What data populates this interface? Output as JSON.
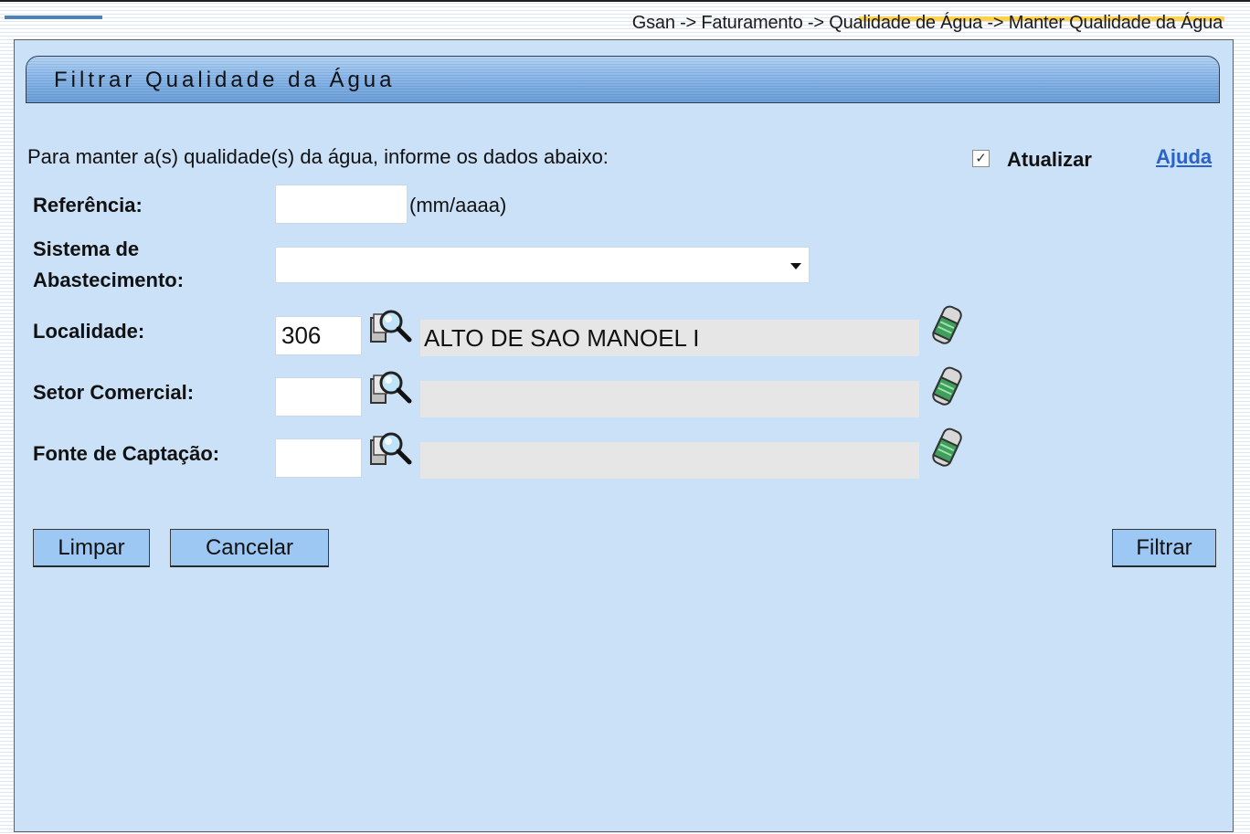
{
  "breadcrumb": "Gsan -> Faturamento -> Qualidade de Água -> Manter Qualidade da Água",
  "panel": {
    "title": "Filtrar Qualidade da Água"
  },
  "form": {
    "intro": "Para manter a(s) qualidade(s) da água, informe os dados abaixo:",
    "atualizar_label": "Atualizar",
    "atualizar_checked": true,
    "ajuda_link": "Ajuda",
    "referencia": {
      "label": "Referência:",
      "value": "",
      "hint": "(mm/aaaa)"
    },
    "sistema": {
      "label_line1": "Sistema de",
      "label_line2": "Abastecimento:",
      "selected": ""
    },
    "localidade": {
      "label": "Localidade:",
      "code": "306",
      "description": "ALTO DE SAO MANOEL I"
    },
    "setor": {
      "label": "Setor Comercial:",
      "code": "",
      "description": ""
    },
    "fonte": {
      "label": "Fonte de Captação:",
      "code": "",
      "description": ""
    }
  },
  "buttons": {
    "limpar": "Limpar",
    "cancelar": "Cancelar",
    "filtrar": "Filtrar"
  },
  "icons": {
    "search": "magnifier-search-icon",
    "clear": "eraser-icon",
    "checkbox": "check-icon"
  },
  "colors": {
    "panel_bg": "#cbe1f8",
    "title_bar": "#8fbbeb",
    "button_bg": "#9cc8f3",
    "link": "#2a62c9",
    "readonly_bg": "#e6e6e6"
  }
}
